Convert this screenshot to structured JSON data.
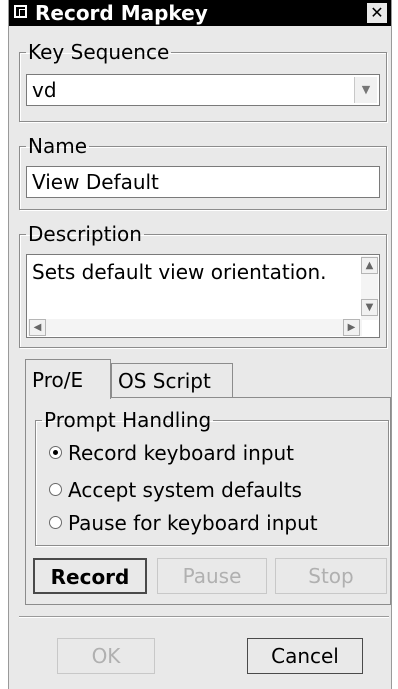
{
  "window": {
    "title": "Record Mapkey",
    "close_glyph": "✕",
    "icon": "window-icon"
  },
  "key_sequence": {
    "legend": "Key Sequence",
    "value": "vd",
    "arrow": "▼"
  },
  "name": {
    "legend": "Name",
    "value": "View Default"
  },
  "description": {
    "legend": "Description",
    "value": "Sets default view orientation.",
    "scroll_up": "▲",
    "scroll_down": "▼",
    "scroll_left": "◀",
    "scroll_right": "▶"
  },
  "tabs": [
    {
      "label": "Pro/E",
      "selected": true
    },
    {
      "label": "OS Script",
      "selected": false
    }
  ],
  "prompt_handling": {
    "legend": "Prompt Handling",
    "options": [
      {
        "label": "Record keyboard input",
        "selected": true
      },
      {
        "label": "Accept system defaults",
        "selected": false
      },
      {
        "label": "Pause for keyboard input",
        "selected": false
      }
    ]
  },
  "record_controls": {
    "record": "Record",
    "pause": "Pause",
    "stop": "Stop"
  },
  "dialog_buttons": {
    "ok": "OK",
    "cancel": "Cancel"
  }
}
